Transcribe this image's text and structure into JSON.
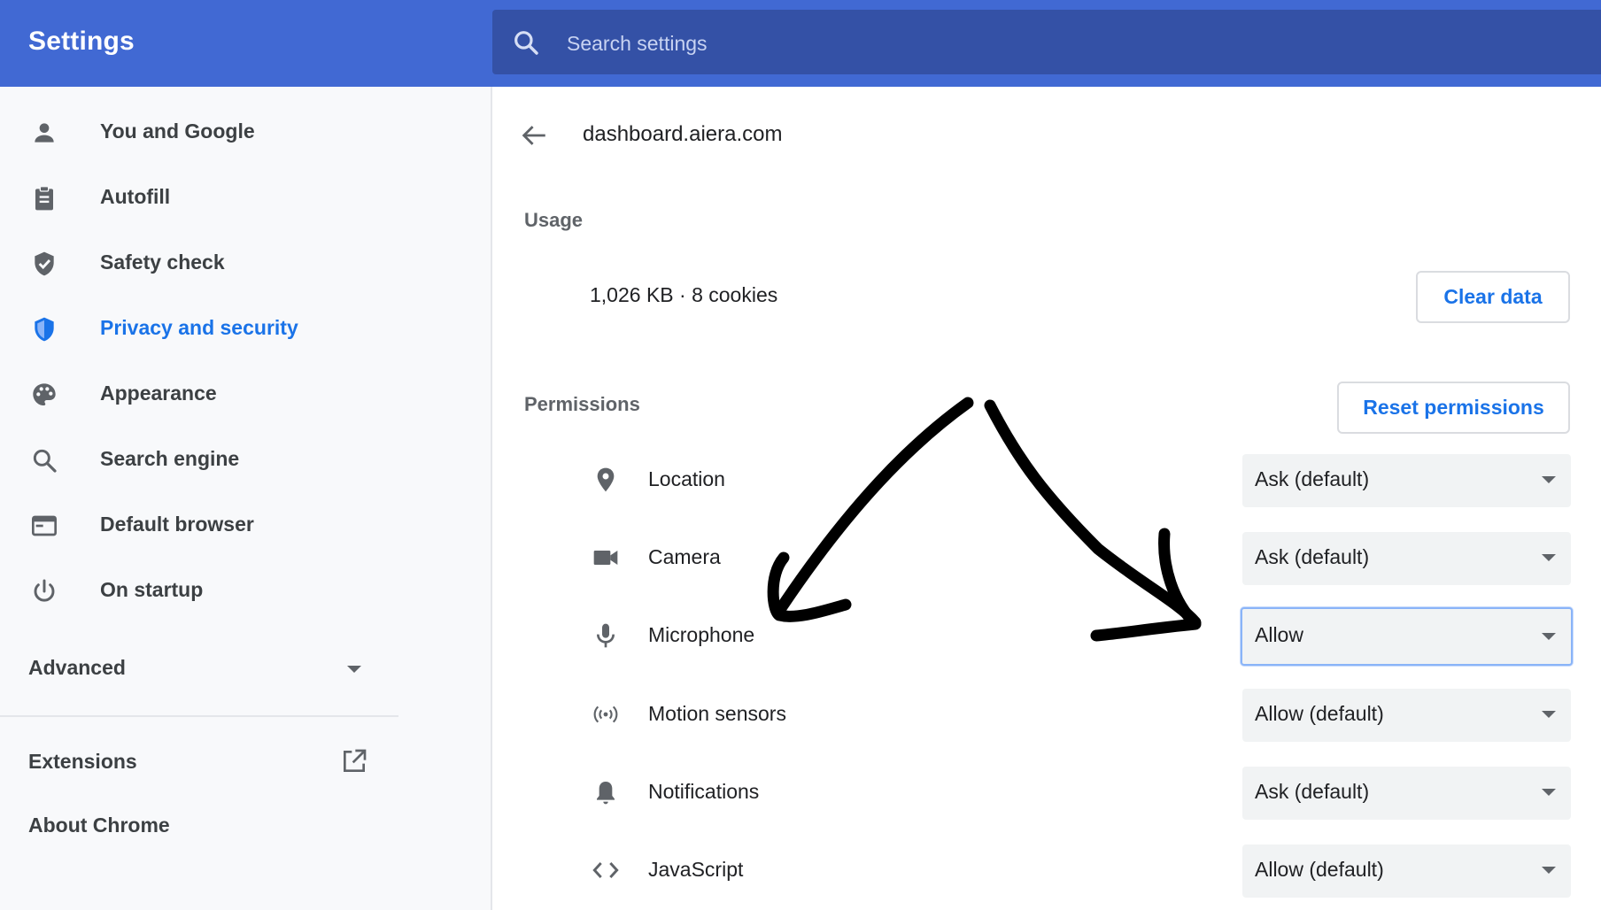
{
  "app": {
    "title": "Settings"
  },
  "search": {
    "placeholder": "Search settings"
  },
  "sidebar": {
    "items": [
      {
        "label": "You and Google",
        "icon": "person-icon"
      },
      {
        "label": "Autofill",
        "icon": "clipboard-icon"
      },
      {
        "label": "Safety check",
        "icon": "shield-check-icon"
      },
      {
        "label": "Privacy and security",
        "icon": "shield-icon",
        "active": true
      },
      {
        "label": "Appearance",
        "icon": "palette-icon"
      },
      {
        "label": "Search engine",
        "icon": "search-icon"
      },
      {
        "label": "Default browser",
        "icon": "browser-icon"
      },
      {
        "label": "On startup",
        "icon": "power-icon"
      }
    ],
    "advanced": "Advanced",
    "extensions": "Extensions",
    "about": "About Chrome"
  },
  "main": {
    "site": "dashboard.aiera.com",
    "usage_heading": "Usage",
    "usage_text": "1,026 KB · 8 cookies",
    "clear_data": "Clear data",
    "permissions_heading": "Permissions",
    "reset_permissions": "Reset permissions",
    "permissions": [
      {
        "label": "Location",
        "value": "Ask (default)",
        "icon": "location-pin-icon"
      },
      {
        "label": "Camera",
        "value": "Ask (default)",
        "icon": "camera-icon"
      },
      {
        "label": "Microphone",
        "value": "Allow",
        "icon": "microphone-icon",
        "focused": true
      },
      {
        "label": "Motion sensors",
        "value": "Allow (default)",
        "icon": "motion-sensor-icon"
      },
      {
        "label": "Notifications",
        "value": "Ask (default)",
        "icon": "bell-icon"
      },
      {
        "label": "JavaScript",
        "value": "Allow (default)",
        "icon": "code-icon"
      }
    ]
  },
  "colors": {
    "header": "#4169d3",
    "search_bg": "#3451a6",
    "accent": "#1a73e8",
    "sidebar_bg": "#f8f9fb"
  }
}
